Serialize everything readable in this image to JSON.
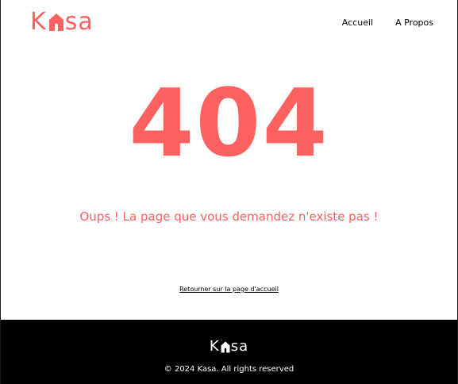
{
  "colors": {
    "brand": "#FF6060",
    "footer_bg": "#000000",
    "text": "#000000",
    "footer_text": "#FFFFFF"
  },
  "header": {
    "logo": {
      "before": "K",
      "icon": "house-icon",
      "after": "sa"
    },
    "nav": [
      {
        "label": "Accueil"
      },
      {
        "label": "A Propos"
      }
    ]
  },
  "main": {
    "error_code": "404",
    "message": "Oups ! La page que vous demandez n'existe pas !",
    "home_link": "Retourner sur la page d'accueil"
  },
  "footer": {
    "logo": {
      "before": "K",
      "icon": "house-icon",
      "after": "sa"
    },
    "copyright": "© 2024 Kasa. All rights reserved"
  }
}
